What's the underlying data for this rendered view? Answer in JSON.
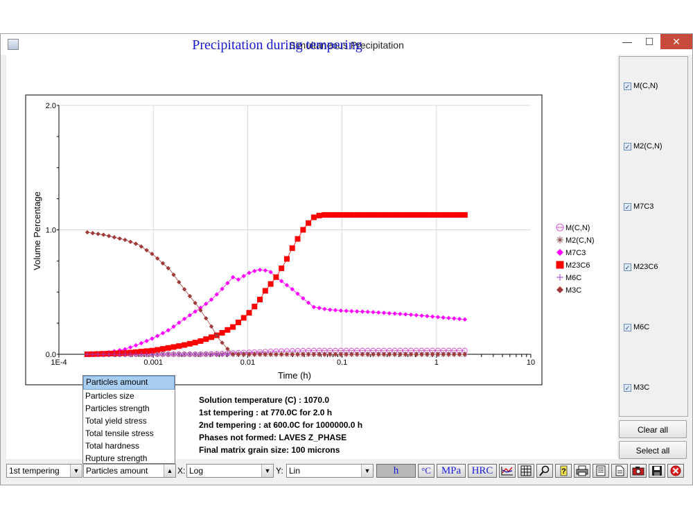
{
  "window": {
    "title": "Simultaneous Precipitation",
    "minimize": "—",
    "maximize": "☐",
    "close": "✕"
  },
  "chart_data": {
    "type": "scatter",
    "title": "Precipitation during tempering",
    "xlabel": "Time (h)",
    "ylabel": "Volume Percentage",
    "xscale": "log",
    "xlim": [
      0.0001,
      10
    ],
    "ylim": [
      0.0,
      2.0
    ],
    "xticks": [
      "1E-4",
      "0.001",
      "0.01",
      "0.1",
      "1",
      "10"
    ],
    "yticks": [
      "0.0",
      "1.0",
      "2.0"
    ],
    "grid": true,
    "legend_position": "right",
    "series": [
      {
        "name": "M(C,N)",
        "color": "#d24ad2",
        "marker": "open-circle",
        "x": [
          0.0002,
          0.0005,
          0.001,
          0.002,
          0.003,
          0.005,
          0.007,
          0.01,
          0.015,
          0.02,
          0.05,
          0.1,
          0.5,
          1,
          2
        ],
        "y": [
          0.0,
          0.0,
          0.0,
          0.0,
          0.0,
          0.005,
          0.01,
          0.015,
          0.02,
          0.025,
          0.03,
          0.03,
          0.03,
          0.03,
          0.03
        ]
      },
      {
        "name": "M2(C,N)",
        "color": "#8a4a4a",
        "marker": "star",
        "x": [
          0.0002,
          0.0005,
          0.001,
          0.002,
          0.005,
          0.01,
          0.1,
          1,
          2
        ],
        "y": [
          0.0,
          0.0,
          0.0,
          0.0,
          0.0,
          0.0,
          0.0,
          0.0,
          0.0
        ]
      },
      {
        "name": "M7C3",
        "color": "#ff00ff",
        "marker": "diamond",
        "x": [
          0.0002,
          0.0003,
          0.0005,
          0.0007,
          0.001,
          0.0015,
          0.002,
          0.003,
          0.004,
          0.005,
          0.007,
          0.008,
          0.01,
          0.013,
          0.017,
          0.02,
          0.03,
          0.04,
          0.05,
          0.07,
          0.1,
          0.2,
          0.5,
          1,
          2
        ],
        "y": [
          0.0,
          0.01,
          0.04,
          0.08,
          0.13,
          0.2,
          0.27,
          0.36,
          0.43,
          0.5,
          0.62,
          0.6,
          0.65,
          0.68,
          0.67,
          0.62,
          0.52,
          0.44,
          0.38,
          0.36,
          0.35,
          0.34,
          0.32,
          0.3,
          0.28
        ]
      },
      {
        "name": "M23C6",
        "color": "#ff0000",
        "marker": "square",
        "x": [
          0.0002,
          0.0005,
          0.001,
          0.002,
          0.003,
          0.005,
          0.007,
          0.01,
          0.013,
          0.015,
          0.02,
          0.025,
          0.03,
          0.04,
          0.05,
          0.06,
          0.07,
          0.1,
          0.2,
          0.5,
          1,
          2
        ],
        "y": [
          0.0,
          0.01,
          0.03,
          0.07,
          0.1,
          0.16,
          0.22,
          0.32,
          0.42,
          0.5,
          0.62,
          0.74,
          0.86,
          1.02,
          1.1,
          1.12,
          1.12,
          1.12,
          1.12,
          1.12,
          1.12,
          1.12
        ]
      },
      {
        "name": "M6C",
        "color": "#a040c8",
        "marker": "plus",
        "x": [
          0.0002,
          0.0005,
          0.001,
          0.002,
          0.005,
          0.01,
          0.1,
          1,
          2
        ],
        "y": [
          0.0,
          0.0,
          0.0,
          0.0,
          0.0,
          0.0,
          0.0,
          0.0,
          0.0
        ]
      },
      {
        "name": "M3C",
        "color": "#a03a3a",
        "marker": "diamond",
        "x": [
          0.0002,
          0.0003,
          0.0005,
          0.0007,
          0.001,
          0.0015,
          0.002,
          0.003,
          0.004,
          0.005,
          0.006,
          0.007,
          0.01,
          0.1,
          1,
          2
        ],
        "y": [
          0.98,
          0.96,
          0.92,
          0.88,
          0.8,
          0.68,
          0.55,
          0.38,
          0.24,
          0.12,
          0.05,
          0.0,
          0.0,
          0.0,
          0.0,
          0.0
        ]
      }
    ]
  },
  "phases_panel": {
    "items": [
      {
        "label": "M(C,N)",
        "checked": true
      },
      {
        "label": "M2(C,N)",
        "checked": true
      },
      {
        "label": "M7C3",
        "checked": true
      },
      {
        "label": "M23C6",
        "checked": true
      },
      {
        "label": "M6C",
        "checked": true
      },
      {
        "label": "M3C",
        "checked": true
      }
    ],
    "check_glyph": "✓",
    "clear_all": "Clear all",
    "select_all": "Select all"
  },
  "info": {
    "line1": "Solution temperature (C) : 1070.0",
    "line2": "1st tempering : at 770.0C for 2.0 h",
    "line3": "2nd tempering : at 600.0C for 1000000.0 h",
    "line4": "Phases not formed: LAVES Z_PHASE",
    "line5": "Final matrix grain size: 100 microns"
  },
  "dropdown_options": [
    "Particles amount",
    "Particles size",
    "Particles strength",
    "Total yield stress",
    "Total tensile stress",
    "Total hardness",
    "Rupture strength"
  ],
  "toolbar": {
    "stage_value": "1st tempering",
    "property_value": "Particles amount",
    "x_label": "X:",
    "x_value": "Log",
    "y_label": "Y:",
    "y_value": "Lin",
    "unit_h": "h",
    "unit_c": "°C",
    "unit_mpa": "MPa",
    "unit_hrc": "HRC",
    "arrow_down": "▼",
    "arrow_up": "▲"
  }
}
